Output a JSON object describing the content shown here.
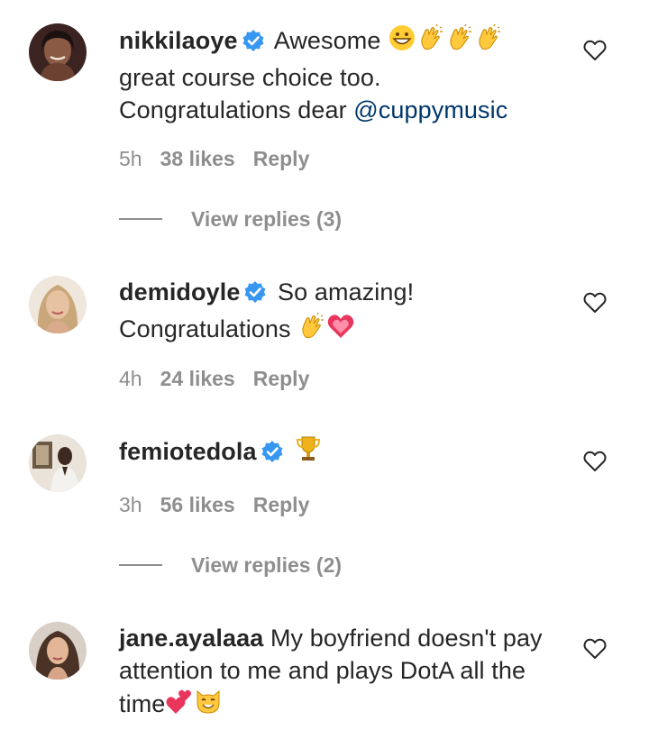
{
  "comments": [
    {
      "username": "nikkilaoye",
      "verified": true,
      "text_line1": "Awesome",
      "text_line2": "great course choice too.",
      "text_line3_prefix": "Congratulations dear ",
      "mention": "@cuppymusic",
      "time": "5h",
      "likes": "38 likes",
      "reply_label": "Reply",
      "view_replies": "View replies (3)"
    },
    {
      "username": "demidoyle",
      "verified": true,
      "text_line1": "So amazing!",
      "text_line2": "Congratulations",
      "time": "4h",
      "likes": "24 likes",
      "reply_label": "Reply"
    },
    {
      "username": "femiotedola",
      "verified": true,
      "time": "3h",
      "likes": "56 likes",
      "reply_label": "Reply",
      "view_replies": "View replies (2)"
    },
    {
      "username": "jane.ayalaaa",
      "verified": false,
      "text_line1": "My boyfriend doesn't pay",
      "text_line2": "attention to me and plays DotA all the",
      "text_line3_prefix": "time"
    }
  ],
  "icons": {
    "like": "heart-outline-icon",
    "verified": "verified-badge-icon"
  },
  "colors": {
    "text": "#262626",
    "meta": "#8e8e8e",
    "mention": "#00376b",
    "verified": "#3897f0"
  }
}
